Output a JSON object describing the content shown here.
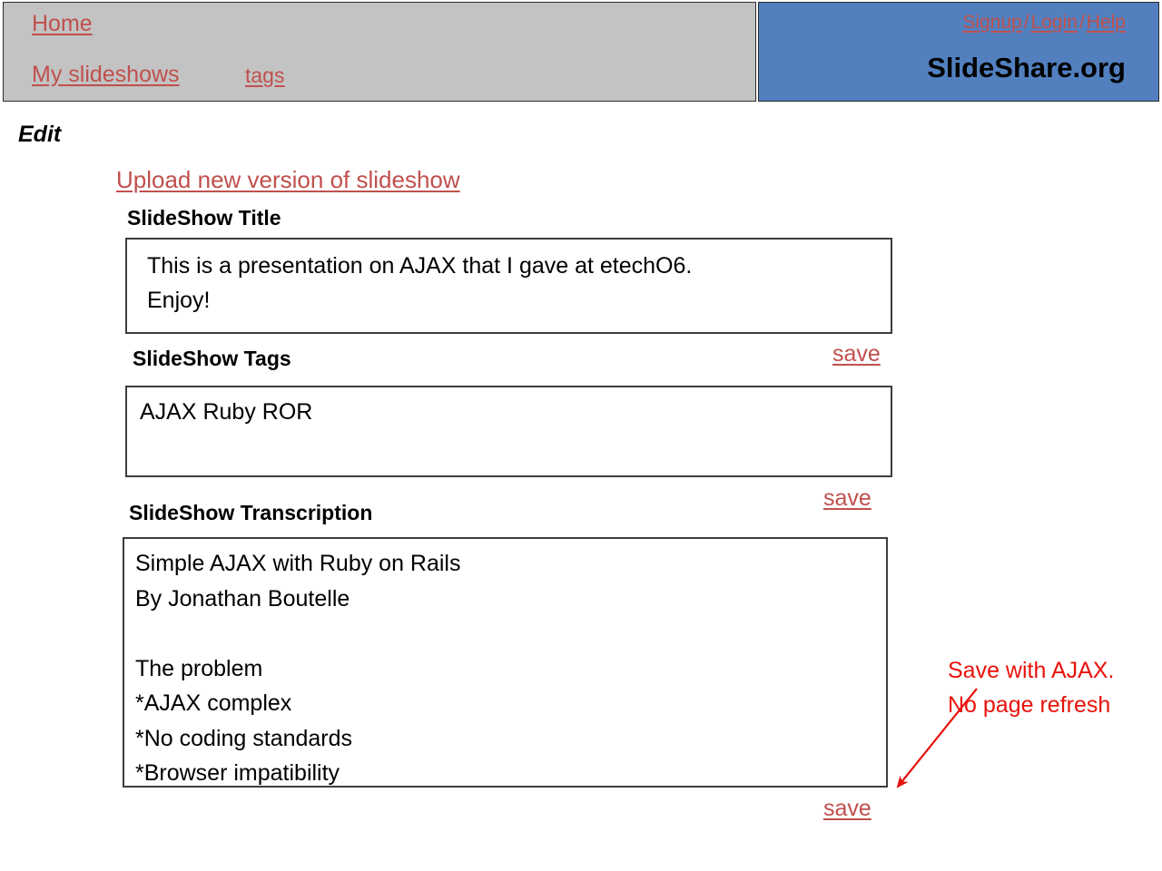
{
  "header": {
    "nav": [
      {
        "label": "Home",
        "name": "nav-home"
      },
      {
        "label": "My slideshows",
        "name": "nav-my-slideshows"
      },
      {
        "label": "tags",
        "name": "nav-tags"
      }
    ],
    "account": {
      "signup": "Signup",
      "separator": "/",
      "login": "Login",
      "help": "Help"
    },
    "brand": "SlideShare.org",
    "colors": {
      "nav_background": "#c3c3c3",
      "brand_background": "#5280bf",
      "link": "#c0504d",
      "annotation": "#e8120b"
    }
  },
  "page": {
    "title": "Edit",
    "upload_link": "Upload new version of slideshow"
  },
  "fields": {
    "title": {
      "label": "SlideShow Title",
      "value": "This is a presentation on AJAX that I gave at etechO6.\nEnjoy!",
      "save_label": "save"
    },
    "tags": {
      "label": "SlideShow Tags",
      "value": "AJAX Ruby ROR",
      "save_label": "save"
    },
    "transcription": {
      "label": "SlideShow Transcription",
      "value": "Simple AJAX with Ruby on Rails\nBy Jonathan Boutelle\n\nThe problem\n*AJAX complex\n*No coding standards\n*Browser impatibility",
      "save_label": "save"
    }
  },
  "annotation": {
    "line1": "Save with AJAX.",
    "line2": "No page refresh"
  }
}
